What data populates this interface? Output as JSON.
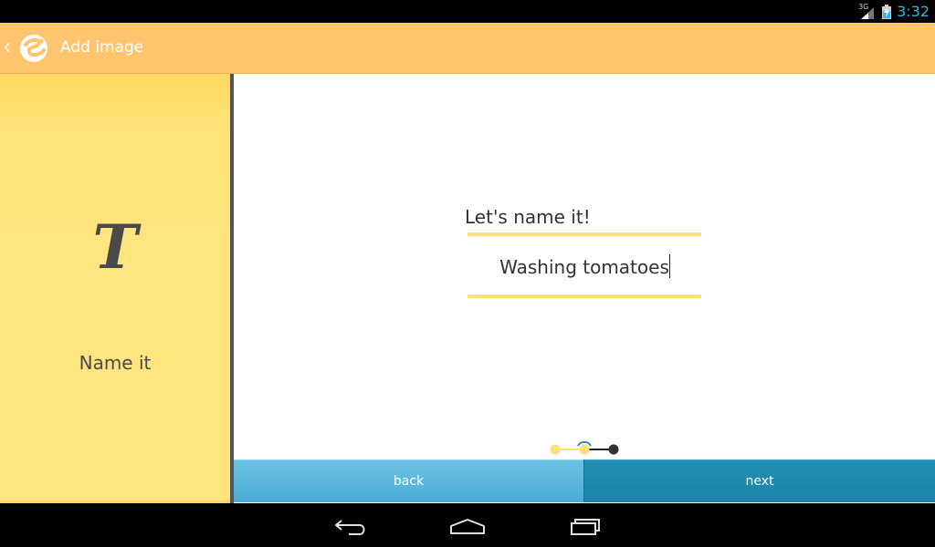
{
  "status_bar": {
    "network_type": "3G",
    "time": "3:32"
  },
  "action_bar": {
    "title": "Add image",
    "color": "#ffc46e"
  },
  "step_panel": {
    "icon_glyph": "T",
    "label": "Name it"
  },
  "form": {
    "prompt": "Let's name it!",
    "name_value": "Washing tomatoes"
  },
  "progress": {
    "current_step": 2,
    "total_steps": 3
  },
  "buttons": {
    "back_label": "back",
    "next_label": "next"
  },
  "colors": {
    "accent_blue": "#33b5e5",
    "panel_yellow": "#ffe580",
    "next_button": "#1b84a8",
    "back_button": "#55b4da"
  },
  "nav_bar": {
    "icons": [
      "back-icon",
      "home-icon",
      "recent-apps-icon"
    ]
  }
}
